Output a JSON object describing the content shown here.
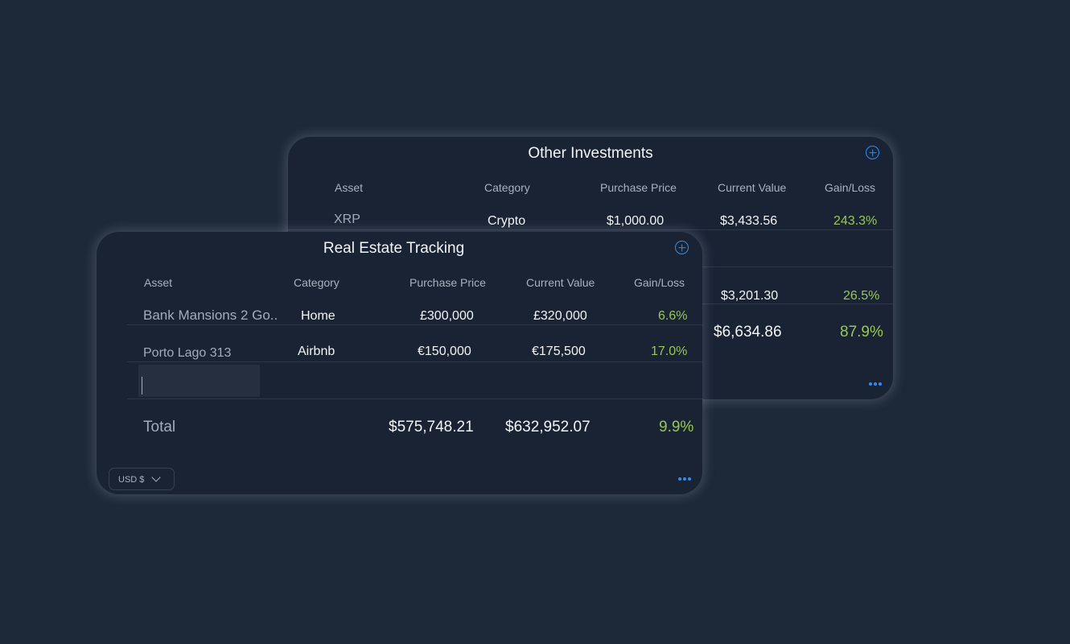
{
  "other_investments": {
    "title": "Other Investments",
    "columns": [
      "Asset",
      "Category",
      "Purchase Price",
      "Current Value",
      "Gain/Loss"
    ],
    "rows": [
      {
        "asset": "XRP",
        "category": "Crypto",
        "purchase": "$1,000.00",
        "current": "$3,433.56",
        "gain": "243.3%"
      },
      {
        "asset": "",
        "category": "",
        "purchase": "",
        "current": "$3,201.30",
        "gain": "26.5%"
      }
    ],
    "total": {
      "current": "$6,634.86",
      "gain": "87.9%"
    }
  },
  "real_estate": {
    "title": "Real Estate Tracking",
    "columns": [
      "Asset",
      "Category",
      "Purchase Price",
      "Current Value",
      "Gain/Loss"
    ],
    "rows": [
      {
        "asset": "Bank Mansions 2 Go..",
        "category": "Home",
        "purchase": "£300,000",
        "current": "£320,000",
        "gain": "6.6%"
      },
      {
        "asset": "Porto Lago 313",
        "category": "Airbnb",
        "purchase": "€150,000",
        "current": "€175,500",
        "gain": "17.0%"
      }
    ],
    "new_asset_value": "",
    "total": {
      "label": "Total",
      "purchase": "$575,748.21",
      "current": "$632,952.07",
      "gain": "9.9%"
    },
    "currency": "USD $"
  },
  "colors": {
    "background": "#1d2838",
    "card": "#1a2334",
    "accent": "#2f8ff0",
    "gain": "#9ac658"
  }
}
